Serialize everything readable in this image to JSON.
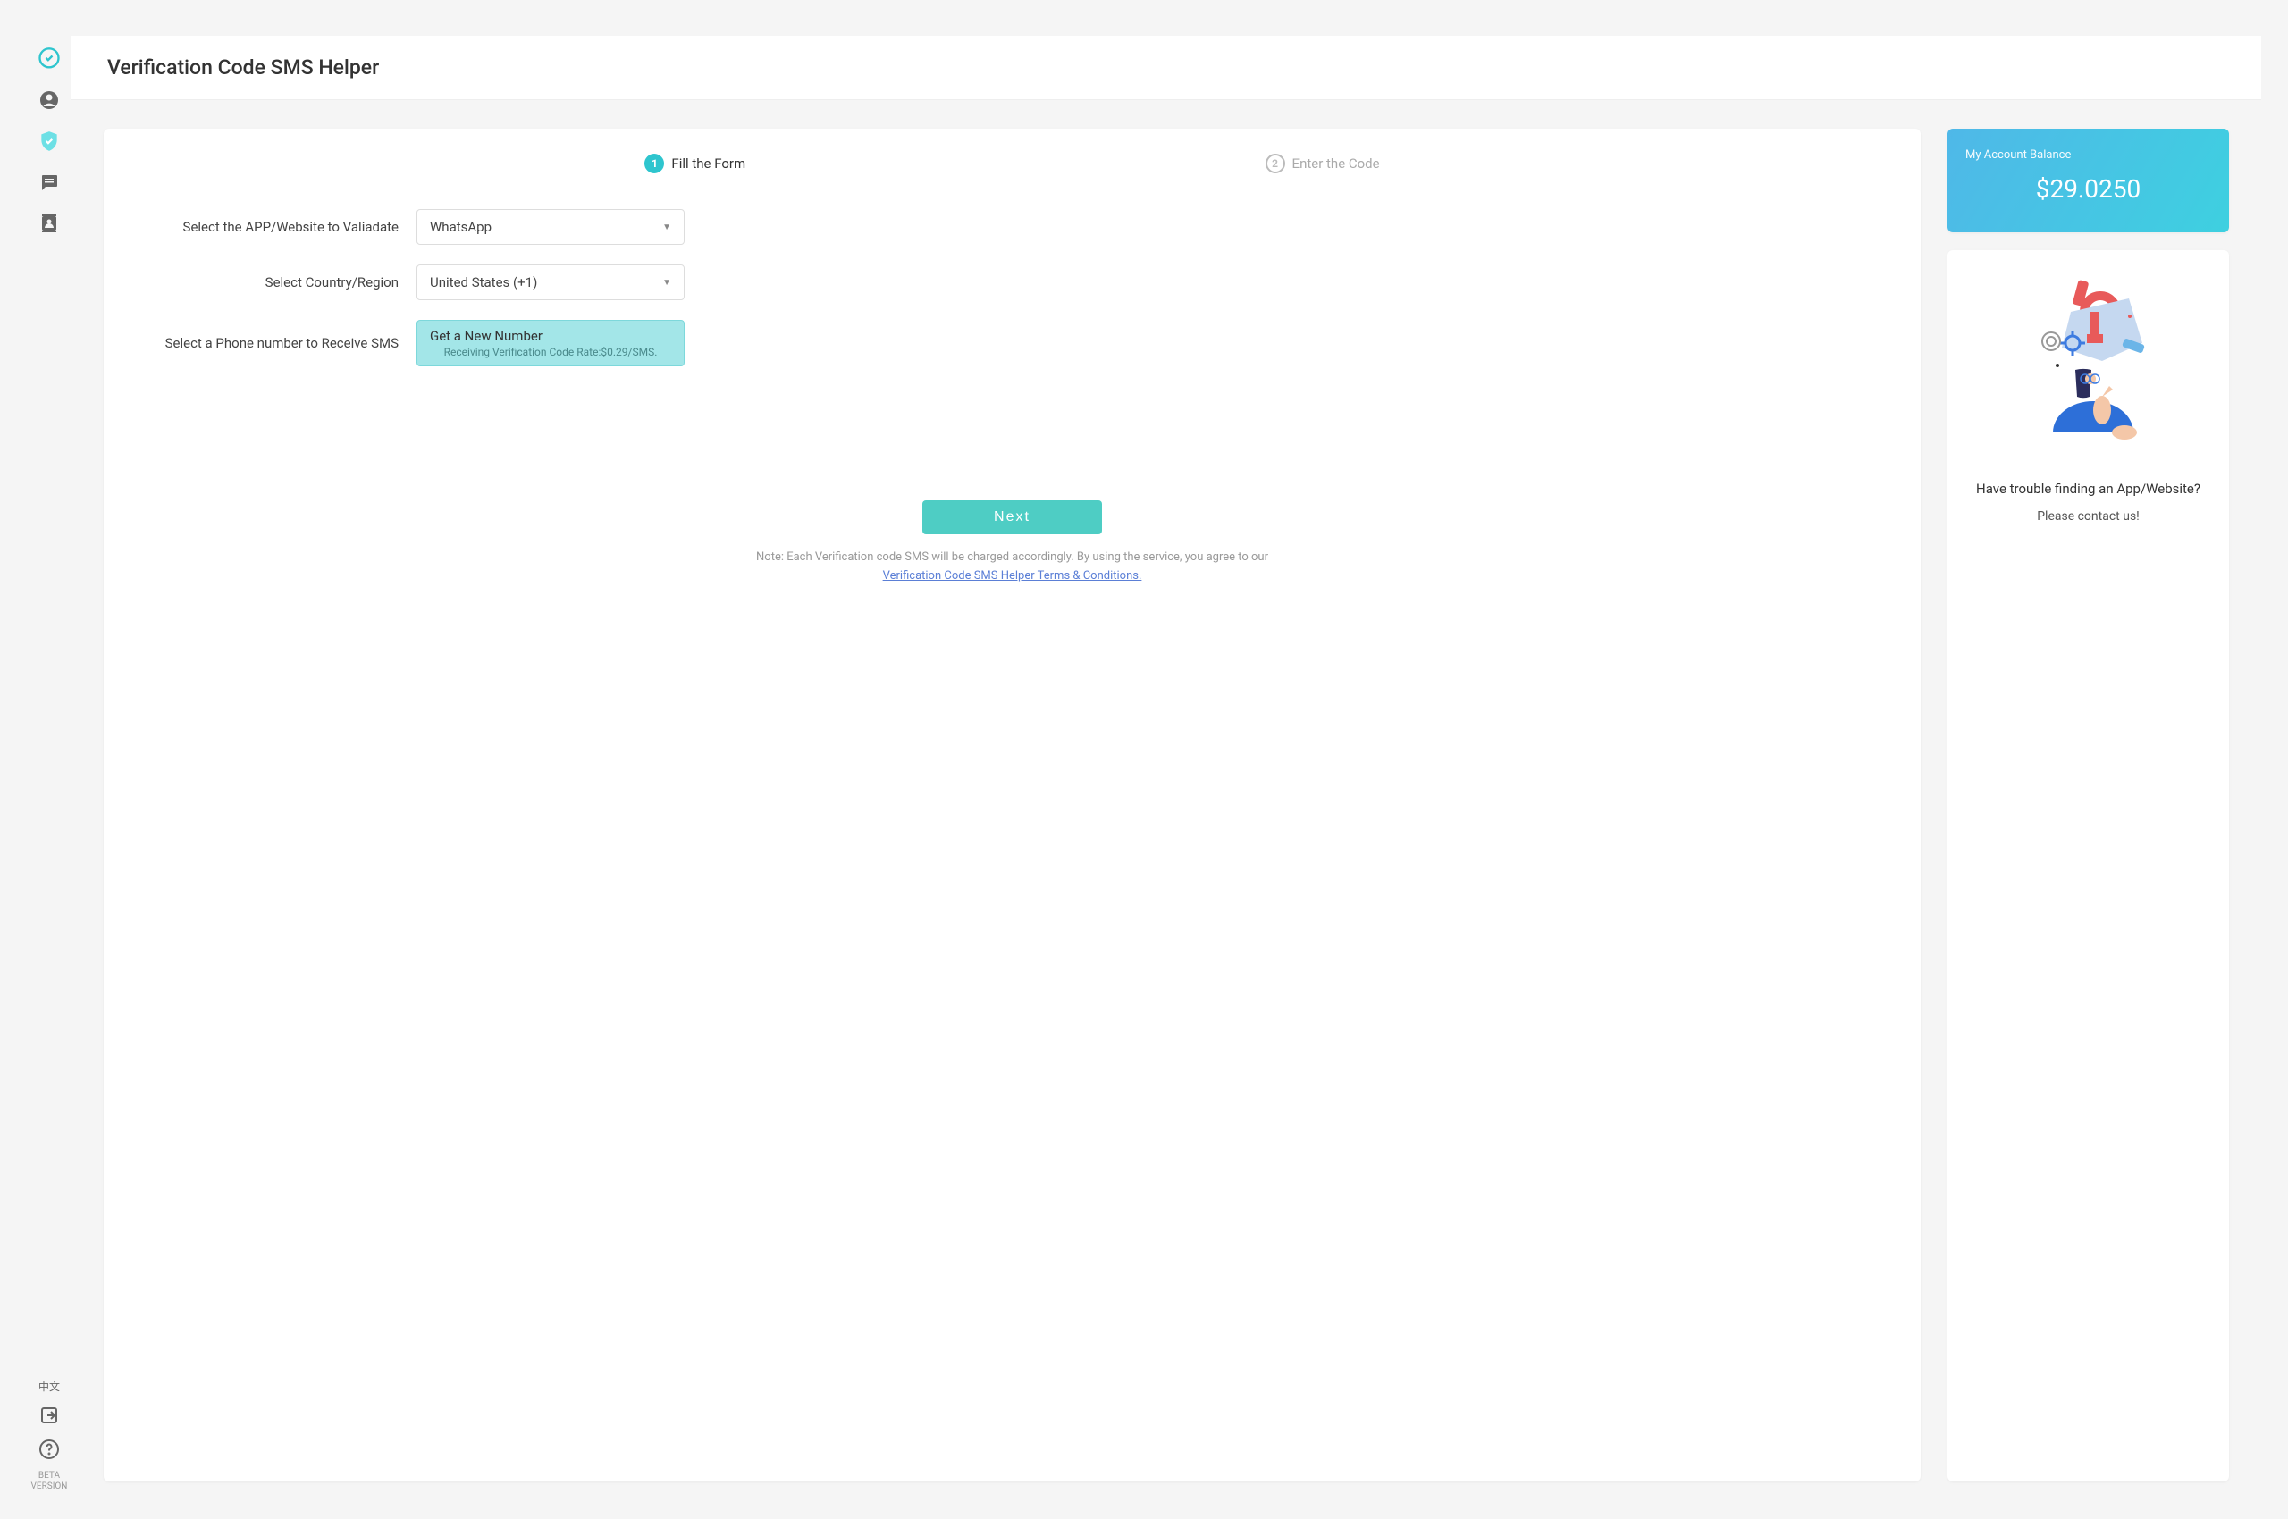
{
  "header": {
    "title": "Verification Code SMS Helper"
  },
  "sidebar": {
    "language": "中文",
    "beta_line1": "BETA",
    "beta_line2": "VERSION"
  },
  "steps": {
    "step1": {
      "number": "1",
      "label": "Fill the Form"
    },
    "step2": {
      "number": "2",
      "label": "Enter the Code"
    }
  },
  "form": {
    "app_label": "Select the APP/Website to Valiadate",
    "app_value": "WhatsApp",
    "country_label": "Select Country/Region",
    "country_value": "United States (+1)",
    "phone_label": "Select a Phone number to Receive SMS",
    "get_number_title": "Get a New Number",
    "get_number_sub": "Receiving Verification Code Rate:$0.29/SMS.",
    "next_label": "Next",
    "note": "Note: Each Verification code SMS will be charged accordingly. By using the service, you agree to our",
    "terms_text": "Verification Code SMS Helper Terms & Conditions."
  },
  "balance": {
    "label": "My Account Balance",
    "value": "$29.0250"
  },
  "help": {
    "title": "Have trouble finding an App/Website?",
    "subtitle": "Please contact us!"
  }
}
